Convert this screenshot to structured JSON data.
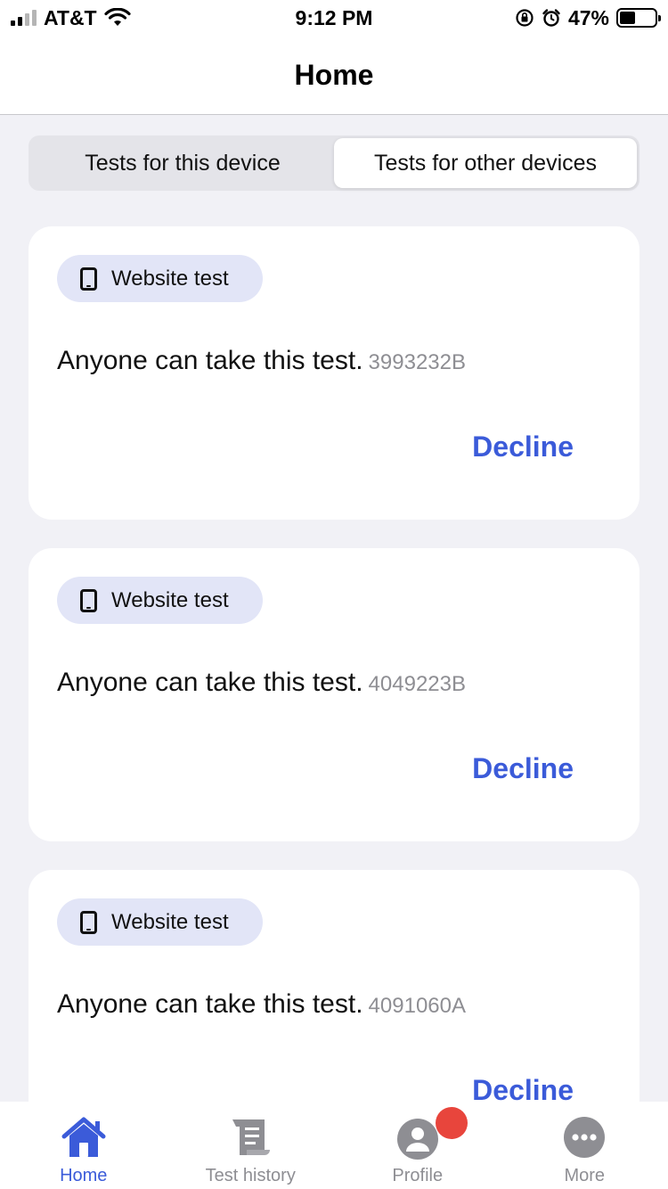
{
  "status_bar": {
    "carrier": "AT&T",
    "time": "9:12 PM",
    "battery_percent": "47%",
    "battery_level": 0.47
  },
  "nav": {
    "title": "Home"
  },
  "segment": {
    "tabs": [
      {
        "label": "Tests for this device",
        "active": false
      },
      {
        "label": "Tests for other devices",
        "active": true
      }
    ]
  },
  "cards": [
    {
      "tag": "Website test",
      "description": "Anyone can take this test.",
      "code": "3993232B",
      "action": "Decline"
    },
    {
      "tag": "Website test",
      "description": "Anyone can take this test.",
      "code": "4049223B",
      "action": "Decline"
    },
    {
      "tag": "Website test",
      "description": "Anyone can take this test.",
      "code": "4091060A",
      "action": "Decline"
    }
  ],
  "tab_bar": {
    "items": [
      {
        "label": "Home",
        "icon": "home-icon",
        "active": true
      },
      {
        "label": "Test history",
        "icon": "scroll-icon",
        "active": false
      },
      {
        "label": "Profile",
        "icon": "profile-icon",
        "active": false
      },
      {
        "label": "More",
        "icon": "more-icon",
        "active": false
      }
    ]
  },
  "colors": {
    "accent": "#3b5bd9",
    "background": "#f1f1f6",
    "badge": "#e8453c",
    "pill": "#e2e5f7"
  }
}
